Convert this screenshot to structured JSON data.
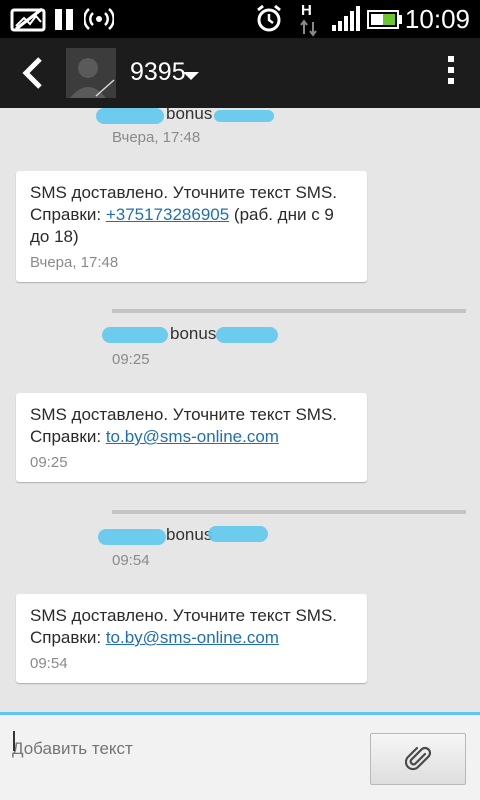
{
  "status_bar": {
    "time": "10:09",
    "network_indicator": "H",
    "icons": [
      "image-off-icon",
      "pause-icon",
      "wifi-hotspot-icon",
      "alarm-icon",
      "network-h-icon",
      "signal-icon",
      "battery-icon"
    ]
  },
  "header": {
    "contact_name": "9395"
  },
  "messages": [
    {
      "type": "sent",
      "text": "bonus",
      "time": "Вчера, 17:48"
    },
    {
      "type": "received",
      "text_before": "SMS доставлено. Уточните текст SMS. Справки: ",
      "link": "+375173286905",
      "text_after": " (раб. дни с 9 до 18)",
      "time": "Вчера, 17:48"
    },
    {
      "type": "sent",
      "text": "bonus",
      "time": "09:25"
    },
    {
      "type": "received",
      "text_before": "SMS доставлено. Уточните текст SMS. Справки: ",
      "link": "to.by@sms-online.com",
      "text_after": "",
      "time": "09:25"
    },
    {
      "type": "sent",
      "text": "bonus",
      "time": "09:54"
    },
    {
      "type": "received",
      "text_before": "SMS доставлено. Уточните текст SMS. Справки: ",
      "link": "to.by@sms-online.com",
      "text_after": "",
      "time": "09:54"
    }
  ],
  "composer": {
    "placeholder": "Добавить текст",
    "attach_icon": "paperclip-icon"
  },
  "colors": {
    "accent": "#5fc8ee",
    "link": "#1f6fb7",
    "header_bg": "#1c1c1c"
  }
}
